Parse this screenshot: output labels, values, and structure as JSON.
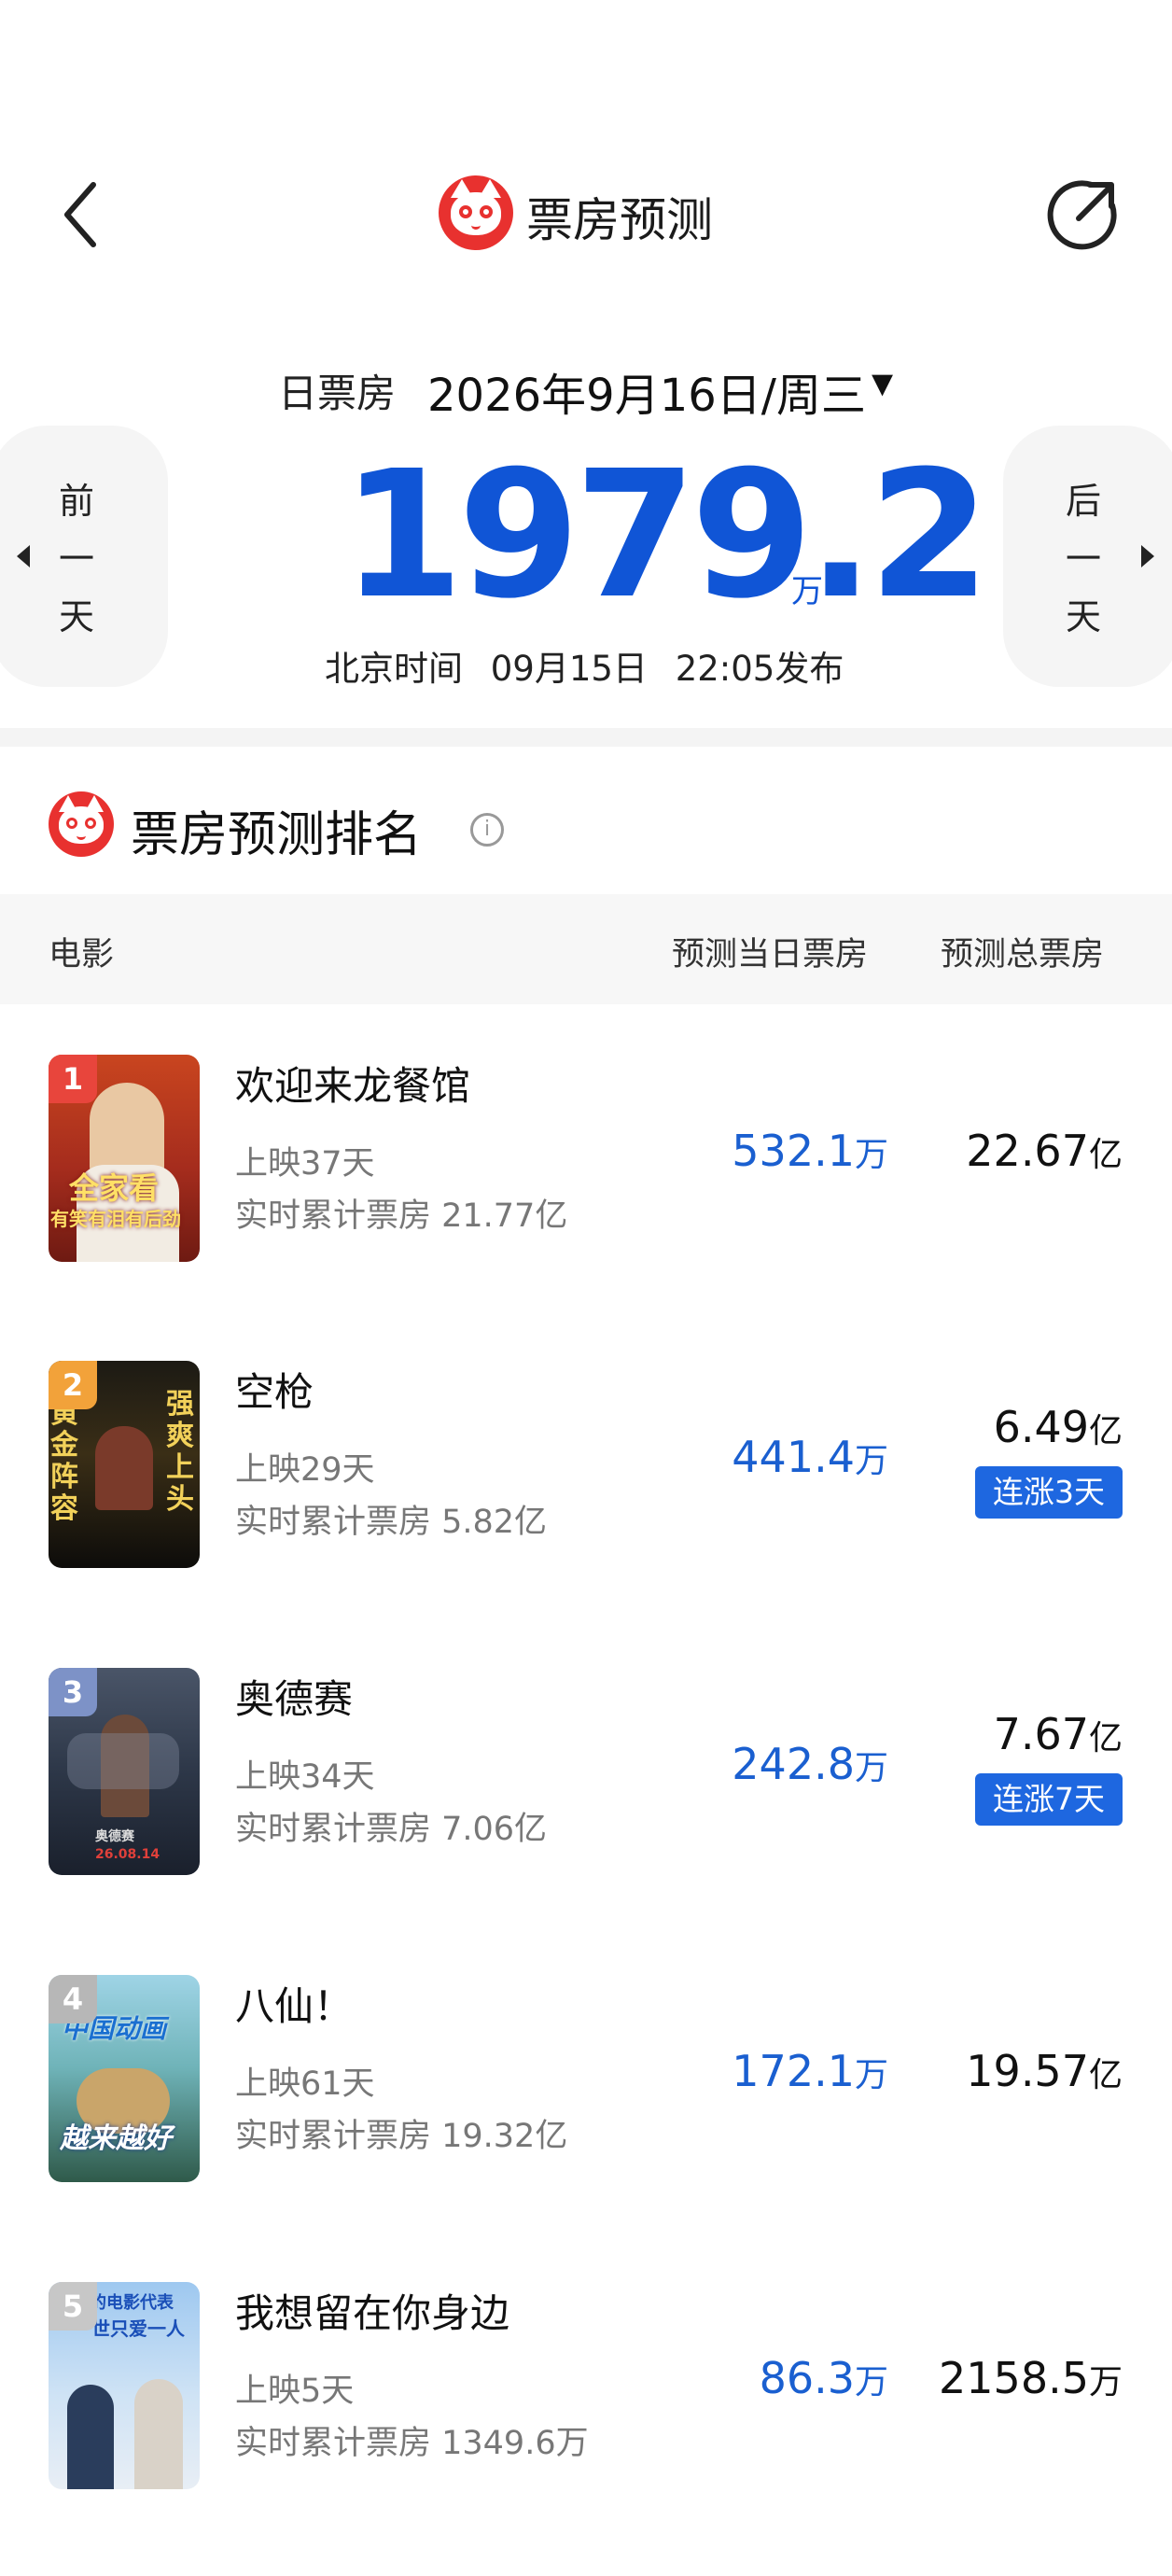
{
  "header": {
    "title": "票房预测"
  },
  "date_bar": {
    "label": "日票房",
    "date": "2026年9月16日/周三",
    "dropdown_arrow": "▾"
  },
  "summary": {
    "prev_day": [
      "前",
      "一",
      "天"
    ],
    "next_day": [
      "后",
      "一",
      "天"
    ],
    "value": "1979.2",
    "unit": "万",
    "time_label": "北京时间",
    "time_date": "09月15日",
    "time_clock": "22:05发布"
  },
  "ranking": {
    "title": "票房预测排名",
    "info_icon": "i",
    "col_movie": "电影",
    "col_daily": "预测当日票房",
    "col_total": "预测总票房",
    "movies": [
      {
        "rank": "1",
        "title": "欢迎来龙餐馆",
        "days": "上映37天",
        "realtime": "实时累计票房 21.77亿",
        "daily_value": "532.1",
        "daily_unit": "万",
        "total_value": "22.67",
        "total_unit": "亿",
        "badge": "",
        "poster_text": [
          "全家看",
          "有笑有泪有后劲"
        ]
      },
      {
        "rank": "2",
        "title": "空枪",
        "days": "上映29天",
        "realtime": "实时累计票房 5.82亿",
        "daily_value": "441.4",
        "daily_unit": "万",
        "total_value": "6.49",
        "total_unit": "亿",
        "badge": "连涨3天",
        "poster_text": [
          "黄金阵容",
          "强爽上头"
        ]
      },
      {
        "rank": "3",
        "title": "奥德赛",
        "days": "上映34天",
        "realtime": "实时累计票房 7.06亿",
        "daily_value": "242.8",
        "daily_unit": "万",
        "total_value": "7.67",
        "total_unit": "亿",
        "badge": "连涨7天",
        "poster_text": [
          "奥德赛",
          "26.08.14"
        ]
      },
      {
        "rank": "4",
        "title": "八仙！",
        "days": "上映61天",
        "realtime": "实时累计票房 19.32亿",
        "daily_value": "172.1",
        "daily_unit": "万",
        "total_value": "19.57",
        "total_unit": "亿",
        "badge": "",
        "poster_text": [
          "中国动画",
          "越来越好"
        ]
      },
      {
        "rank": "5",
        "title": "我想留在你身边",
        "days": "上映5天",
        "realtime": "实时累计票房 1349.6万",
        "daily_value": "86.3",
        "daily_unit": "万",
        "total_value": "2158.5",
        "total_unit": "万",
        "badge": "",
        "poster_text": [
          "神的电影代表",
          "一世只爱一人"
        ]
      }
    ]
  },
  "colors": {
    "accent_blue": "#1a5fd0",
    "badge_blue": "#1e67e0",
    "brand_red": "#e8312f"
  }
}
